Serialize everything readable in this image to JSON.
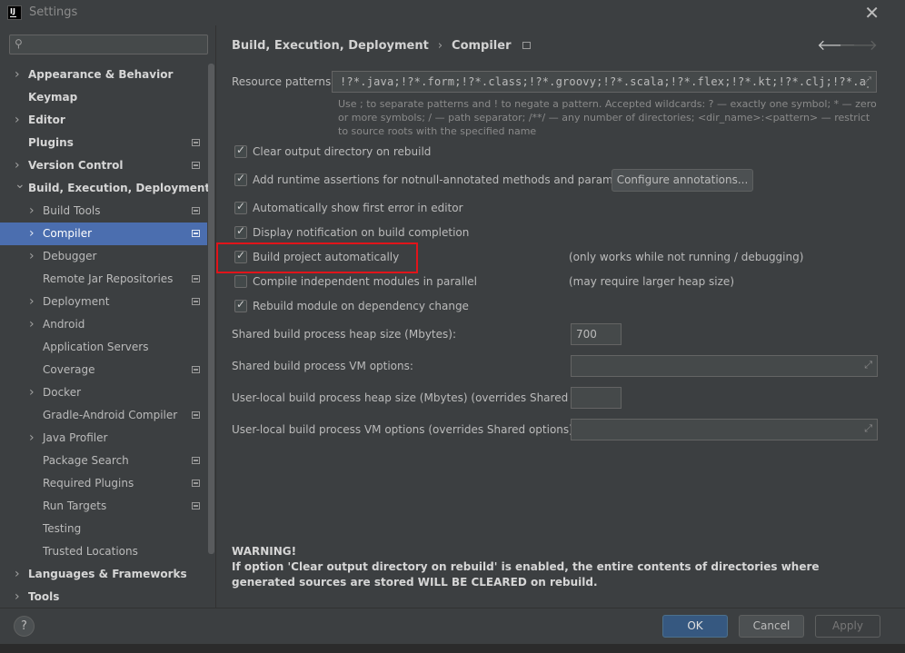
{
  "window": {
    "title": "Settings",
    "app_icon_text": "IJ"
  },
  "search": {
    "placeholder": "",
    "value": ""
  },
  "sidebar": {
    "items": [
      {
        "label": "Appearance & Behavior",
        "level": 0,
        "arrow": true,
        "bold": true,
        "proj": false,
        "selected": false,
        "name": "sidebar-item-appearance-behavior"
      },
      {
        "label": "Keymap",
        "level": 0,
        "arrow": false,
        "bold": true,
        "proj": false,
        "selected": false,
        "name": "sidebar-item-keymap"
      },
      {
        "label": "Editor",
        "level": 0,
        "arrow": true,
        "bold": true,
        "proj": false,
        "selected": false,
        "name": "sidebar-item-editor"
      },
      {
        "label": "Plugins",
        "level": 0,
        "arrow": false,
        "bold": true,
        "proj": true,
        "selected": false,
        "name": "sidebar-item-plugins"
      },
      {
        "label": "Version Control",
        "level": 0,
        "arrow": true,
        "bold": true,
        "proj": true,
        "selected": false,
        "name": "sidebar-item-version-control"
      },
      {
        "label": "Build, Execution, Deployment",
        "level": 0,
        "arrow": true,
        "expanded": true,
        "bold": true,
        "proj": false,
        "selected": false,
        "name": "sidebar-item-build-execution-deployment"
      },
      {
        "label": "Build Tools",
        "level": 1,
        "arrow": true,
        "bold": false,
        "proj": true,
        "selected": false,
        "name": "sidebar-item-build-tools"
      },
      {
        "label": "Compiler",
        "level": 1,
        "arrow": true,
        "bold": false,
        "proj": true,
        "selected": true,
        "name": "sidebar-item-compiler"
      },
      {
        "label": "Debugger",
        "level": 1,
        "arrow": true,
        "bold": false,
        "proj": false,
        "selected": false,
        "name": "sidebar-item-debugger"
      },
      {
        "label": "Remote Jar Repositories",
        "level": 1,
        "arrow": false,
        "bold": false,
        "proj": true,
        "selected": false,
        "name": "sidebar-item-remote-jar-repositories"
      },
      {
        "label": "Deployment",
        "level": 1,
        "arrow": true,
        "bold": false,
        "proj": true,
        "selected": false,
        "name": "sidebar-item-deployment"
      },
      {
        "label": "Android",
        "level": 1,
        "arrow": true,
        "bold": false,
        "proj": false,
        "selected": false,
        "name": "sidebar-item-android"
      },
      {
        "label": "Application Servers",
        "level": 1,
        "arrow": false,
        "bold": false,
        "proj": false,
        "selected": false,
        "name": "sidebar-item-application-servers"
      },
      {
        "label": "Coverage",
        "level": 1,
        "arrow": false,
        "bold": false,
        "proj": true,
        "selected": false,
        "name": "sidebar-item-coverage"
      },
      {
        "label": "Docker",
        "level": 1,
        "arrow": true,
        "bold": false,
        "proj": false,
        "selected": false,
        "name": "sidebar-item-docker"
      },
      {
        "label": "Gradle-Android Compiler",
        "level": 1,
        "arrow": false,
        "bold": false,
        "proj": true,
        "selected": false,
        "name": "sidebar-item-gradle-android-compiler"
      },
      {
        "label": "Java Profiler",
        "level": 1,
        "arrow": true,
        "bold": false,
        "proj": false,
        "selected": false,
        "name": "sidebar-item-java-profiler"
      },
      {
        "label": "Package Search",
        "level": 1,
        "arrow": false,
        "bold": false,
        "proj": true,
        "selected": false,
        "name": "sidebar-item-package-search"
      },
      {
        "label": "Required Plugins",
        "level": 1,
        "arrow": false,
        "bold": false,
        "proj": true,
        "selected": false,
        "name": "sidebar-item-required-plugins"
      },
      {
        "label": "Run Targets",
        "level": 1,
        "arrow": false,
        "bold": false,
        "proj": true,
        "selected": false,
        "name": "sidebar-item-run-targets"
      },
      {
        "label": "Testing",
        "level": 1,
        "arrow": false,
        "bold": false,
        "proj": false,
        "selected": false,
        "name": "sidebar-item-testing"
      },
      {
        "label": "Trusted Locations",
        "level": 1,
        "arrow": false,
        "bold": false,
        "proj": false,
        "selected": false,
        "name": "sidebar-item-trusted-locations"
      },
      {
        "label": "Languages & Frameworks",
        "level": 0,
        "arrow": true,
        "bold": true,
        "proj": false,
        "selected": false,
        "name": "sidebar-item-languages-frameworks"
      },
      {
        "label": "Tools",
        "level": 0,
        "arrow": true,
        "bold": true,
        "proj": false,
        "selected": false,
        "name": "sidebar-item-tools"
      }
    ]
  },
  "breadcrumb": {
    "parent": "Build, Execution, Deployment",
    "current": "Compiler"
  },
  "compiler": {
    "resource_patterns_label": "Resource patterns:",
    "resource_patterns_value": "!?*.java;!?*.form;!?*.class;!?*.groovy;!?*.scala;!?*.flex;!?*.kt;!?*.clj;!?*.aj",
    "hint": "Use ; to separate patterns and ! to negate a pattern. Accepted wildcards: ? — exactly one symbol; * — zero or more symbols; / — path separator; /**/ — any number of directories; <dir_name>:<pattern> — restrict to source roots with the specified name",
    "checkboxes": [
      {
        "label": "Clear output directory on rebuild",
        "checked": true,
        "note": ""
      },
      {
        "label": "Add runtime assertions for notnull-annotated methods and parameters",
        "checked": true,
        "note": ""
      },
      {
        "label": "Automatically show first error in editor",
        "checked": true,
        "note": ""
      },
      {
        "label": "Display notification on build completion",
        "checked": true,
        "note": ""
      },
      {
        "label": "Build project automatically",
        "checked": true,
        "note": "(only works while not running / debugging)"
      },
      {
        "label": "Compile independent modules in parallel",
        "checked": false,
        "note": "(may require larger heap size)"
      },
      {
        "label": "Rebuild module on dependency change",
        "checked": true,
        "note": ""
      }
    ],
    "configure_annotations_label": "Configure annotations...",
    "shared_heap_label": "Shared build process heap size (Mbytes):",
    "shared_heap_value": "700",
    "shared_vm_label": "Shared build process VM options:",
    "shared_vm_value": "",
    "user_heap_label": "User-local build process heap size (Mbytes) (overrides Shared size):",
    "user_heap_value": "",
    "user_vm_label": "User-local build process VM options (overrides Shared options):",
    "user_vm_value": "",
    "warning_title": "WARNING!",
    "warning_text": "If option 'Clear output directory on rebuild' is enabled, the entire contents of directories where generated sources are stored WILL BE CLEARED on rebuild."
  },
  "footer": {
    "help_label": "?",
    "ok_label": "OK",
    "cancel_label": "Cancel",
    "apply_label": "Apply"
  },
  "colors": {
    "selection": "#4b6eaf",
    "highlight_box": "#e1141a",
    "primary_button": "#365880"
  }
}
